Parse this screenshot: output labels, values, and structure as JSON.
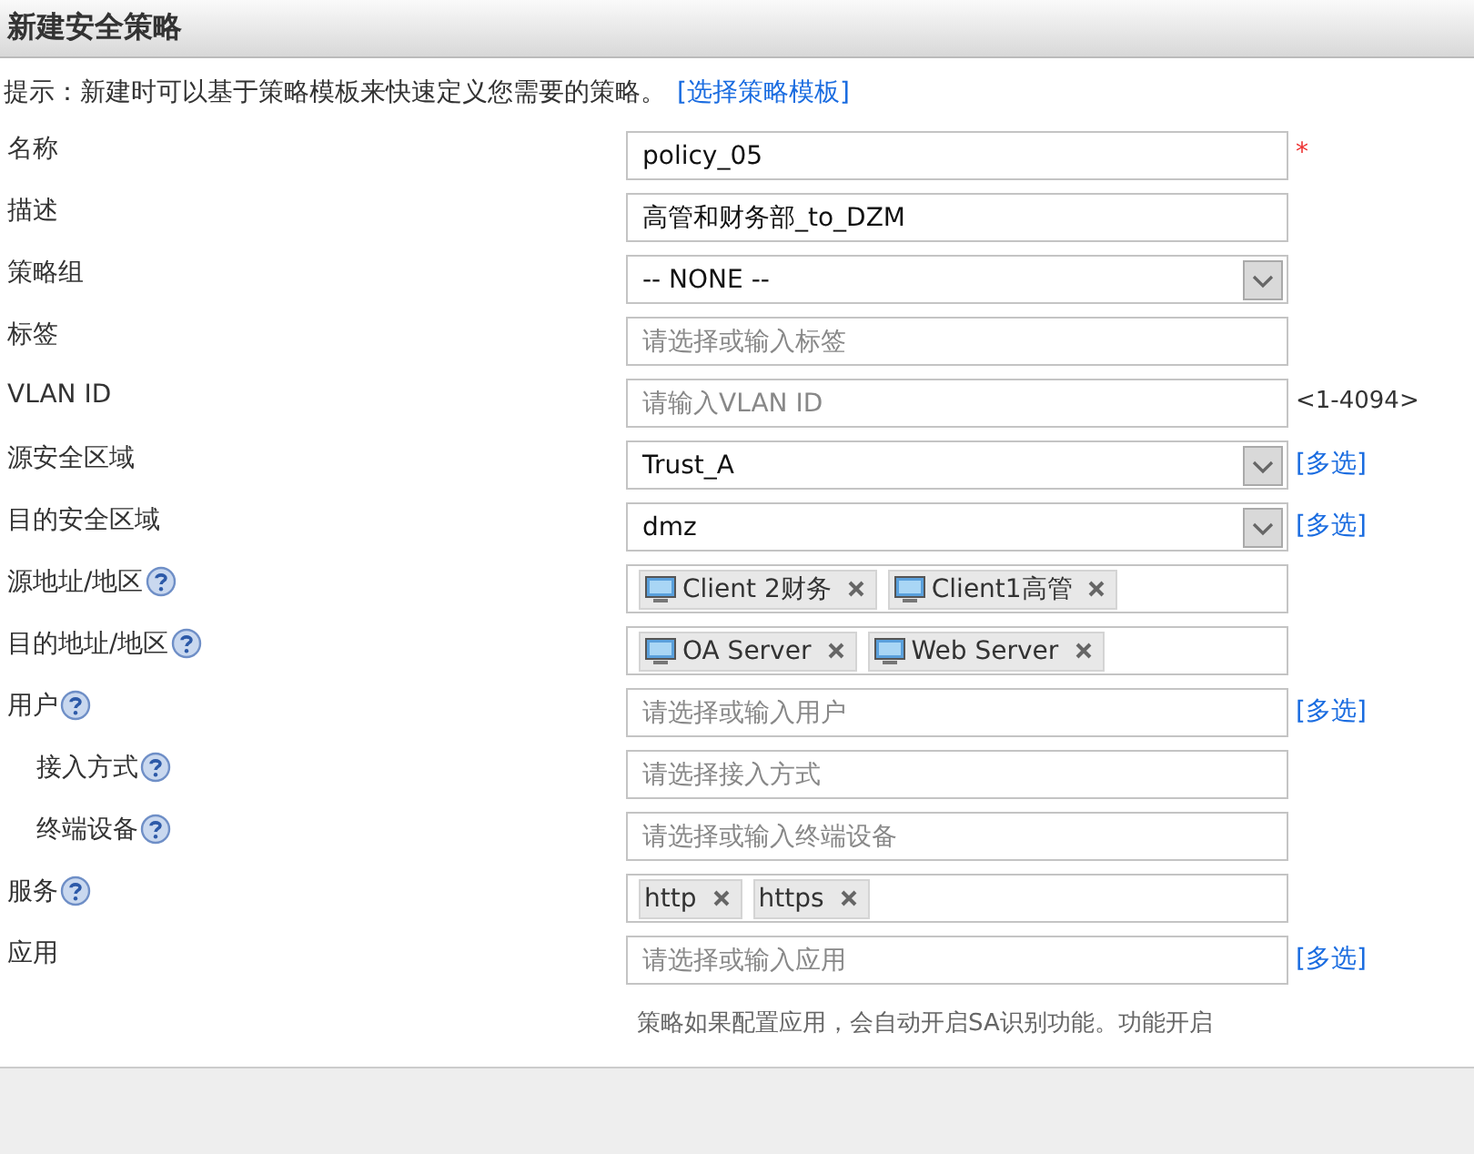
{
  "title": "新建安全策略",
  "hint": {
    "text": "提示：新建时可以基于策略模板来快速定义您需要的策略。",
    "link": "[选择策略模板]"
  },
  "fields": [
    {
      "label": "名称",
      "help": false,
      "kind": "text",
      "value": "policy_05",
      "suffix": {
        "kind": "required",
        "text": "*"
      }
    },
    {
      "label": "描述",
      "help": false,
      "kind": "text",
      "value": "高管和财务部_to_DZM"
    },
    {
      "label": "策略组",
      "help": false,
      "kind": "select",
      "value": "-- NONE --"
    },
    {
      "label": "标签",
      "help": false,
      "kind": "text",
      "placeholder": "请选择或输入标签"
    },
    {
      "label": "VLAN ID",
      "help": false,
      "kind": "text",
      "placeholder": "请输入VLAN ID",
      "suffix": {
        "kind": "range",
        "text": "<1-4094>"
      }
    },
    {
      "label": "源安全区域",
      "help": false,
      "kind": "select",
      "value": "Trust_A",
      "suffix": {
        "kind": "link",
        "text": "[多选]"
      }
    },
    {
      "label": "目的安全区域",
      "help": false,
      "kind": "select",
      "value": "dmz",
      "suffix": {
        "kind": "link",
        "text": "[多选]"
      }
    },
    {
      "label": "源地址/地区",
      "help": true,
      "kind": "tags",
      "tags": [
        {
          "kind": "host",
          "text": "Client 2财务"
        },
        {
          "kind": "host",
          "text": "Client1高管"
        }
      ]
    },
    {
      "label": "目的地址/地区",
      "help": true,
      "kind": "tags",
      "tags": [
        {
          "kind": "host",
          "text": "OA Server"
        },
        {
          "kind": "host",
          "text": "Web Server"
        }
      ]
    },
    {
      "label": "用户",
      "help": true,
      "kind": "text",
      "placeholder": "请选择或输入用户",
      "suffix": {
        "kind": "link",
        "text": "[多选]"
      },
      "children": [
        {
          "label": "接入方式",
          "help": true,
          "kind": "text",
          "placeholder": "请选择接入方式"
        },
        {
          "label": "终端设备",
          "help": true,
          "kind": "text",
          "placeholder": "请选择或输入终端设备"
        }
      ]
    },
    {
      "label": "服务",
      "help": true,
      "kind": "tags",
      "tags": [
        {
          "kind": "plain",
          "text": "http"
        },
        {
          "kind": "plain",
          "text": "https"
        }
      ]
    },
    {
      "label": "应用",
      "help": false,
      "kind": "text",
      "placeholder": "请选择或输入应用",
      "suffix": {
        "kind": "link",
        "text": "[多选]"
      },
      "note": "策略如果配置应用，会自动开启SA识别功能。功能开启"
    }
  ]
}
